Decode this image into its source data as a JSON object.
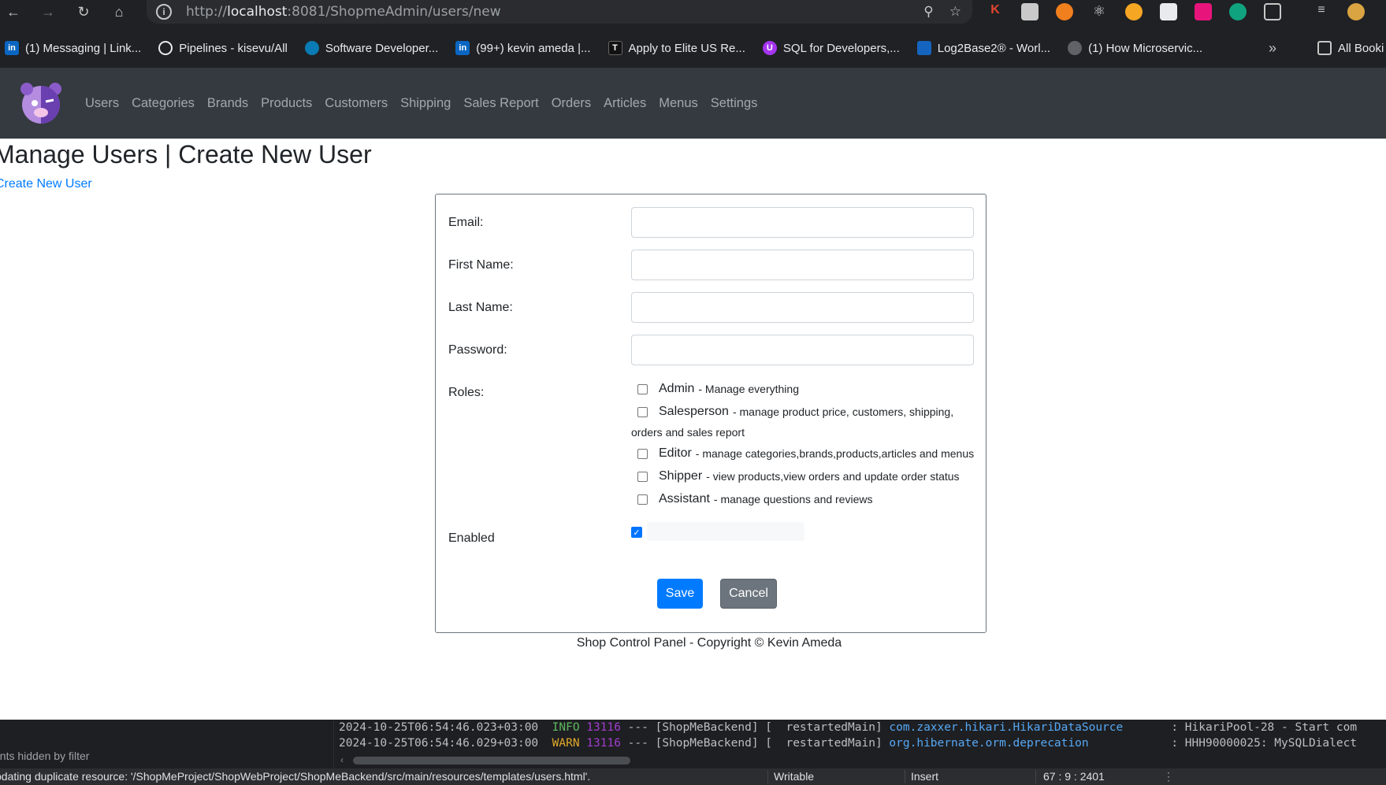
{
  "browser": {
    "url_prefix": "http://",
    "url_host": "localhost",
    "url_rest": ":8081/ShopmeAdmin/users/new",
    "bookmarks": [
      {
        "label": "(1) Messaging | Link...",
        "icon": "linkedin-icon",
        "color": "#0a66c2"
      },
      {
        "label": "Pipelines - kisevu/All",
        "icon": "azure-pipelines-icon",
        "color": "#2b2c2f"
      },
      {
        "label": "Software Developer...",
        "icon": "globe-icon",
        "color": "#0a7bb5"
      },
      {
        "label": "(99+) kevin ameda |...",
        "icon": "linkedin-icon",
        "color": "#0a66c2"
      },
      {
        "label": "Apply to Elite US Re...",
        "icon": "turing-icon",
        "color": "#111111"
      },
      {
        "label": "SQL for Developers,...",
        "icon": "udemy-icon",
        "color": "#a435f0"
      },
      {
        "label": "Log2Base2® - Worl...",
        "icon": "log2base2-icon",
        "color": "#1565c0"
      },
      {
        "label": "(1) How Microservic...",
        "icon": "world-icon",
        "color": "#5f6368"
      }
    ],
    "all_bookmarks_label": "All Booki"
  },
  "app": {
    "nav": [
      "Users",
      "Categories",
      "Brands",
      "Products",
      "Customers",
      "Shipping",
      "Sales Report",
      "Orders",
      "Articles",
      "Menus",
      "Settings"
    ]
  },
  "page": {
    "title": "Manage Users | Create New User",
    "subtitle": "Create New User"
  },
  "form": {
    "email_label": "Email:",
    "first_name_label": "First Name:",
    "last_name_label": "Last Name:",
    "password_label": "Password:",
    "roles_label": "Roles:",
    "enabled_label": "Enabled",
    "roles": [
      {
        "name": "Admin",
        "desc": "- Manage everything",
        "checked": false
      },
      {
        "name": "Salesperson",
        "desc": "- manage product price, customers, shipping,",
        "desc_cont": "orders and sales report",
        "checked": false
      },
      {
        "name": "Editor",
        "desc": "- manage categories,brands,products,articles and menus",
        "checked": false
      },
      {
        "name": "Shipper",
        "desc": "- view products,view orders and update order status",
        "checked": false
      },
      {
        "name": "Assistant",
        "desc": "- manage questions and reviews",
        "checked": false
      }
    ],
    "enabled": true,
    "save_label": "Save",
    "cancel_label": "Cancel"
  },
  "footer": "Shop Control Panel - Copyright © Kevin Ameda",
  "ide": {
    "left_text": "ents hidden by filter",
    "log": [
      {
        "ts": "2024-10-25T06:54:46.023+03:00",
        "level": "INFO ",
        "pid": "13116",
        "mid": " --- [ShopMeBackend] [  restartedMain] ",
        "cls": "com.zaxxer.hikari.HikariDataSource",
        "msg": "       : HikariPool-28 - Start com"
      },
      {
        "ts": "2024-10-25T06:54:46.029+03:00",
        "level": "WARN ",
        "pid": "13116",
        "mid": " --- [ShopMeBackend] [  restartedMain] ",
        "cls": "org.hibernate.orm.deprecation",
        "msg": "            : HHH90000025: MySQLDialect"
      }
    ],
    "status_message": "pdating duplicate resource: '/ShopMeProject/ShopWebProject/ShopMeBackend/src/main/resources/templates/users.html'.",
    "writable": "Writable",
    "insert": "Insert",
    "position": "67 : 9 : 2401"
  }
}
